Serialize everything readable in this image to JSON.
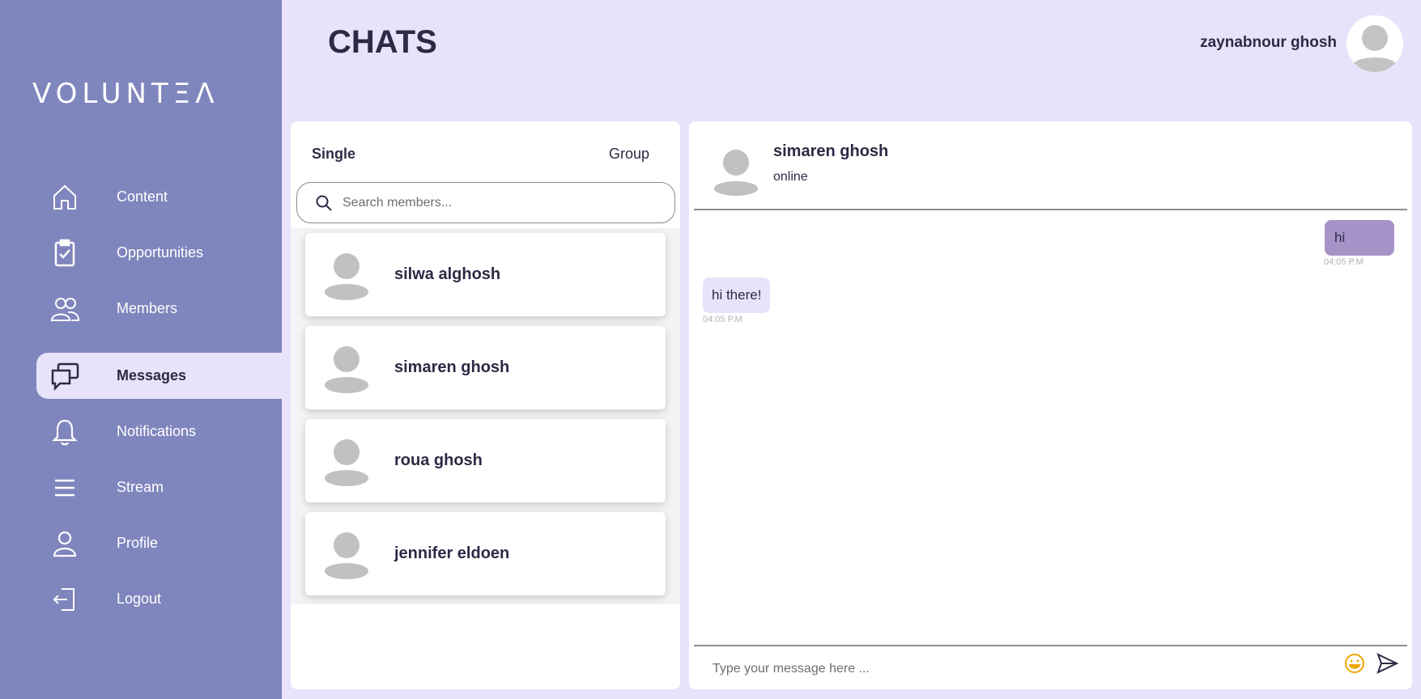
{
  "sidebar": {
    "logo": "VOLUNTΞΛ",
    "items": [
      {
        "label": "Content",
        "icon": "home-icon"
      },
      {
        "label": "Opportunities",
        "icon": "clipboard-check-icon"
      },
      {
        "label": "Members",
        "icon": "users-icon"
      },
      {
        "label": "Messages",
        "icon": "chat-icon",
        "active": true
      },
      {
        "label": "Notifications",
        "icon": "bell-icon"
      },
      {
        "label": "Stream",
        "icon": "menu-icon"
      },
      {
        "label": "Profile",
        "icon": "user-icon"
      },
      {
        "label": "Logout",
        "icon": "logout-icon"
      }
    ]
  },
  "header": {
    "title": "CHATS",
    "user_name": "zaynabnour ghosh"
  },
  "chat_list": {
    "tabs": {
      "single": "Single",
      "group": "Group"
    },
    "search": {
      "placeholder": "Search members...",
      "value": ""
    },
    "members": [
      {
        "name": "silwa alghosh"
      },
      {
        "name": "simaren ghosh"
      },
      {
        "name": "roua ghosh"
      },
      {
        "name": "jennifer eldoen"
      }
    ]
  },
  "conversation": {
    "contact_name": "simaren ghosh",
    "status": "online",
    "messages": [
      {
        "direction": "out",
        "text": "hi",
        "time": "04:05 P.M"
      },
      {
        "direction": "in",
        "text": "hi there!",
        "time": "04:05 P.M"
      }
    ],
    "input": {
      "placeholder": "Type your message here ...",
      "value": ""
    }
  },
  "colors": {
    "sidebar_bg": "#7f85bd",
    "page_bg": "#e8e3fb",
    "outgoing_bubble": "#a793c8",
    "incoming_bubble": "#e8e3fb",
    "emoji_accent": "#f0a500"
  }
}
